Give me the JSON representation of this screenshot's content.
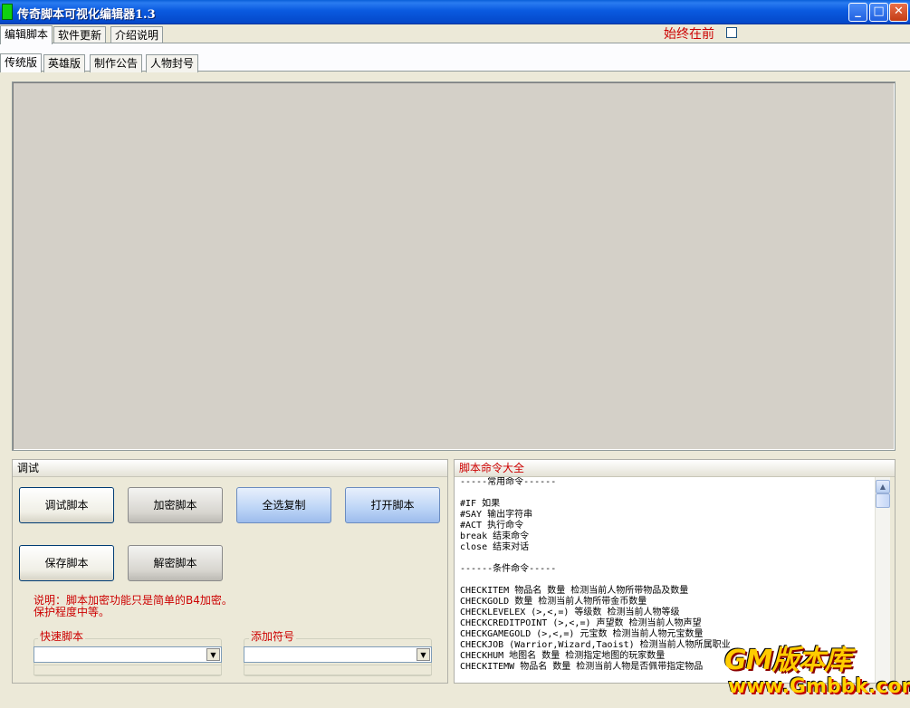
{
  "window": {
    "title": "传奇脚本可视化编辑器1.3",
    "controls": {
      "minimize": "_",
      "maximize": "□",
      "close": "✕"
    }
  },
  "top_tabs": [
    "编辑脚本",
    "软件更新",
    "介绍说明"
  ],
  "always_on_top": {
    "label": "始终在前",
    "checked": false
  },
  "sub_tabs": [
    "传统版",
    "英雄版",
    "制作公告",
    "人物封号"
  ],
  "debug_panel": {
    "title": "调试",
    "buttons": {
      "debug": "调试脚本",
      "encrypt": "加密脚本",
      "select_copy": "全选复制",
      "open": "打开脚本",
      "save": "保存脚本",
      "decrypt": "解密脚本"
    },
    "note_line1": "说明：脚本加密功能只是简单的B4加密。",
    "note_line2": "保护程度中等。",
    "quick_script_label": "快速脚本",
    "add_symbol_label": "添加符号"
  },
  "commands_panel": {
    "title": "脚本命令大全",
    "lines": [
      "-----常用命令------",
      "",
      "#IF 如果",
      "#SAY 输出字符串",
      "#ACT 执行命令",
      "break 结束命令",
      "close 结束对话",
      "",
      "------条件命令-----",
      "",
      "CHECKITEM 物品名 数量 检测当前人物所带物品及数量",
      "CHECKGOLD 数量 检测当前人物所带金币数量",
      "CHECKLEVELEX (>,<,=) 等级数 检测当前人物等级",
      "CHECKCREDITPOINT (>,<,=) 声望数 检测当前人物声望",
      "CHECKGAMEGOLD (>,<,=) 元宝数 检测当前人物元宝数量",
      "CHECKJOB (Warrior,Wizard,Taoist) 检测当前人物所属职业",
      "CHECKHUM 地图名 数量 检测指定地图的玩家数量",
      "CHECKITEMW 物品名 数量 检测当前人物是否佩带指定物品"
    ]
  },
  "watermark": {
    "top": "GM版本库",
    "bottom": "www.Gmbbk.com"
  },
  "colors": {
    "title_bar": "#0a5ae0",
    "accent_red": "#cc0000",
    "panel_bg": "#ece9d8",
    "canvas_bg": "#d4d0c8"
  }
}
